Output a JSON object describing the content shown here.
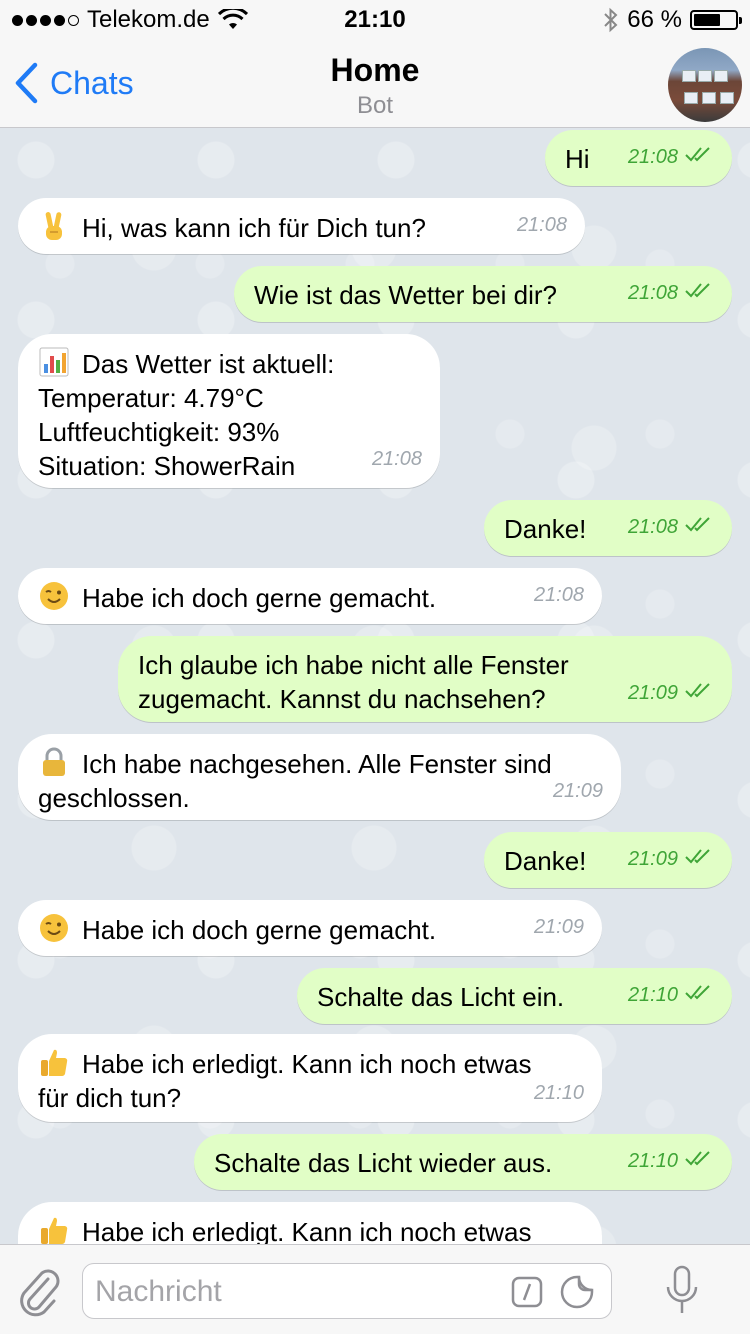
{
  "status_bar": {
    "carrier": "Telekom.de",
    "time": "21:10",
    "battery": "66 %",
    "battery_level": 0.66
  },
  "header": {
    "back_label": "Chats",
    "title": "Home",
    "subtitle": "Bot"
  },
  "messages": [
    {
      "dir": "out",
      "text": "Hi",
      "time": "21:08"
    },
    {
      "dir": "in",
      "emoji": "victory",
      "text": "Hi, was kann ich für Dich tun?",
      "time": "21:08"
    },
    {
      "dir": "out",
      "text": "Wie ist das Wetter bei dir?",
      "time": "21:08"
    },
    {
      "dir": "in",
      "emoji": "chart",
      "text": "Das Wetter ist aktuell:\nTemperatur: 4.79°C\nLuftfeuchtigkeit: 93%\nSituation: ShowerRain",
      "time": "21:08"
    },
    {
      "dir": "out",
      "text": "Danke!",
      "time": "21:08"
    },
    {
      "dir": "in",
      "emoji": "wink",
      "text": "Habe ich doch gerne gemacht.",
      "time": "21:08"
    },
    {
      "dir": "out",
      "text": "Ich glaube ich habe nicht alle Fenster\nzugemacht. Kannst du nachsehen?",
      "time": "21:09"
    },
    {
      "dir": "in",
      "emoji": "lock",
      "text": "Ich habe nachgesehen. Alle Fenster sind\ngeschlossen.",
      "time": "21:09"
    },
    {
      "dir": "out",
      "text": "Danke!",
      "time": "21:09"
    },
    {
      "dir": "in",
      "emoji": "wink",
      "text": "Habe ich doch gerne gemacht.",
      "time": "21:09"
    },
    {
      "dir": "out",
      "text": "Schalte das Licht ein.",
      "time": "21:10"
    },
    {
      "dir": "in",
      "emoji": "thumbs-up",
      "text": "Habe ich erledigt. Kann ich noch etwas\nfür dich tun?",
      "time": "21:10"
    },
    {
      "dir": "out",
      "text": "Schalte das Licht wieder aus.",
      "time": "21:10"
    },
    {
      "dir": "in",
      "emoji": "thumbs-up",
      "text": "Habe ich erledigt. Kann ich noch etwas\nfür dich tun?",
      "time": ""
    }
  ],
  "composer": {
    "placeholder": "Nachricht"
  },
  "colors": {
    "accent": "#1f7bf6",
    "outgoing_bubble": "#e1fec6",
    "incoming_bubble": "#ffffff",
    "read_check": "#3fa537"
  }
}
